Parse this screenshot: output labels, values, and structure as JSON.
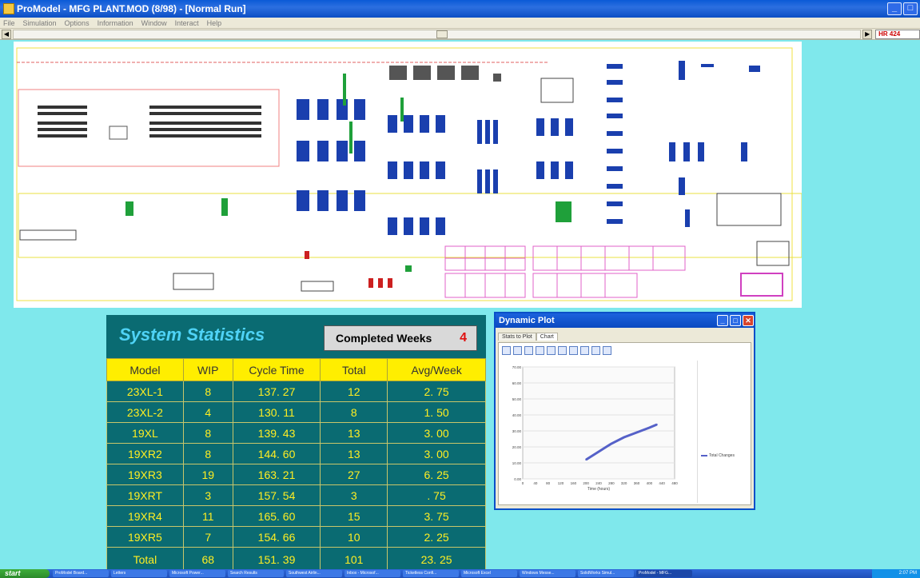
{
  "window": {
    "title": "ProModel - MFG PLANT.MOD (8/98) - [Normal Run]",
    "min_label": "_",
    "max_label": "□"
  },
  "menu": [
    "File",
    "Simulation",
    "Options",
    "Information",
    "Window",
    "Interact",
    "Help"
  ],
  "clock": {
    "label": "HR 424"
  },
  "stats": {
    "title": "System Statistics",
    "completed_label": "Completed Weeks",
    "completed_value": "4",
    "headers": [
      "Model",
      "WIP",
      "Cycle Time",
      "Total",
      "Avg/Week"
    ],
    "rows": [
      [
        "23XL-1",
        "8",
        "137. 27",
        "12",
        "2. 75"
      ],
      [
        "23XL-2",
        "4",
        "130. 11",
        "8",
        "1. 50"
      ],
      [
        "19XL",
        "8",
        "139. 43",
        "13",
        "3. 00"
      ],
      [
        "19XR2",
        "8",
        "144. 60",
        "13",
        "3. 00"
      ],
      [
        "19XR3",
        "19",
        "163. 21",
        "27",
        "6. 25"
      ],
      [
        "19XRT",
        "3",
        "157. 54",
        "3",
        ". 75"
      ],
      [
        "19XR4",
        "11",
        "165. 60",
        "15",
        "3. 75"
      ],
      [
        "19XR5",
        "7",
        "154. 66",
        "10",
        "2. 25"
      ],
      [
        "Total",
        "68",
        "151. 39",
        "101",
        "23. 25"
      ]
    ]
  },
  "dynamic_plot": {
    "title": "Dynamic Plot",
    "tabs": [
      "Stats to Plot",
      "Chart"
    ],
    "active_tab": "Chart",
    "legend": "Total Changes",
    "xlabel": "Time (hours)",
    "series_color": "#5561c8"
  },
  "chart_data": {
    "type": "line",
    "title": "",
    "xlabel": "Time (hours)",
    "ylabel": "",
    "x_ticks": [
      "0",
      "40",
      "80",
      "120",
      "160",
      "200",
      "240",
      "280",
      "320",
      "360",
      "400",
      "440",
      "480"
    ],
    "y_ticks": [
      "0.00",
      "10.00",
      "20.00",
      "30.00",
      "40.00",
      "50.00",
      "60.00",
      "70.00"
    ],
    "xlim": [
      0,
      480
    ],
    "ylim": [
      0,
      70
    ],
    "series": [
      {
        "name": "Total Changes",
        "x": [
          200,
          240,
          280,
          320,
          360,
          400,
          424
        ],
        "y": [
          12,
          17,
          22,
          26,
          29,
          32,
          34
        ]
      }
    ]
  },
  "taskbar": {
    "start": "start",
    "items": [
      "ProModel Board...",
      "Letters",
      "Microsoft Power...",
      "Search Results",
      "Southwest Airlin...",
      "Inbox - Microsof...",
      "Ticketless Confi...",
      "Microsoft Excel",
      "Windows Messe...",
      "SolidWorks Simul...",
      "ProModel - MFG..."
    ],
    "clock": "2:07 PM"
  }
}
